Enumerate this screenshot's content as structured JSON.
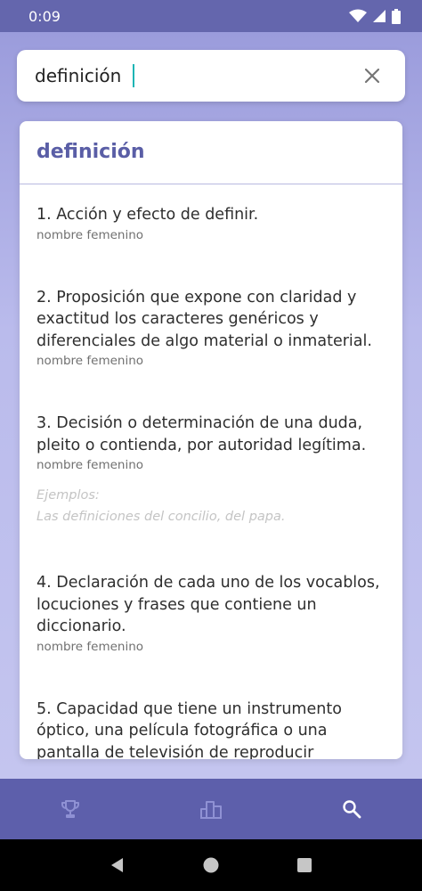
{
  "status_bar": {
    "time": "0:09",
    "icons": [
      "wifi-icon",
      "signal-icon",
      "battery-icon"
    ]
  },
  "search": {
    "value": "definición",
    "clear_icon": "close-icon"
  },
  "entry": {
    "title": "definición",
    "definitions": [
      {
        "text": "1. Acción y efecto de definir.",
        "category": "nombre femenino"
      },
      {
        "text": "2. Proposición que expone con claridad y exactitud los caracteres genéricos y diferenciales de algo material o inmaterial.",
        "category": "nombre femenino"
      },
      {
        "text": "3. Decisión o determinación de una duda, pleito o contienda, por autoridad legítima.",
        "category": "nombre femenino",
        "examples_label": "Ejemplos:",
        "example": "Las definiciones del concilio, del papa."
      },
      {
        "text": "4. Declaración de cada uno de los vocablos, locuciones y frases que contiene un diccionario.",
        "category": "nombre femenino"
      },
      {
        "text": "5. Capacidad que tiene un instrumento óptico, una película fotográfica o una pantalla de televisión de reproducir",
        "category": ""
      }
    ]
  },
  "bottom_nav": {
    "items": [
      "trophy-icon",
      "chart-icon",
      "search-icon"
    ],
    "active": "search-icon"
  },
  "colors": {
    "accent": "#5a5ea6",
    "nav_bg": "#5d5fab",
    "status_bg": "#6466ad",
    "caret": "#1bb5b5"
  }
}
